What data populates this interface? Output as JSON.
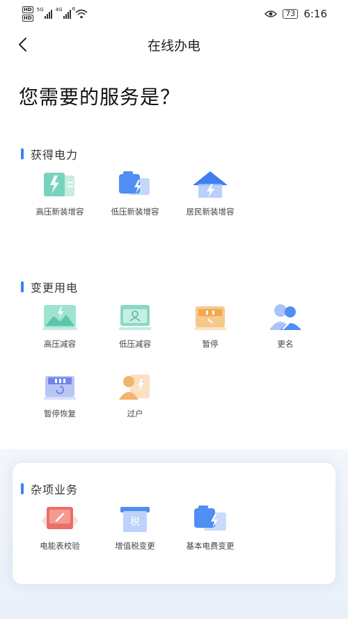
{
  "status_bar": {
    "hd1": "HD",
    "hd2": "HD",
    "net1": "5G",
    "net2": "4G",
    "wifi_badge": "6",
    "battery": "73",
    "time": "6:16"
  },
  "nav": {
    "title": "在线办电"
  },
  "page_title": "您需要的服务是？",
  "sections": [
    {
      "title": "获得电力",
      "items": [
        {
          "label": "高压新装增容",
          "icon": "high-voltage-install-icon"
        },
        {
          "label": "低压新装增容",
          "icon": "low-voltage-install-icon"
        },
        {
          "label": "居民新装增容",
          "icon": "resident-install-icon"
        }
      ]
    },
    {
      "title": "变更用电",
      "items": [
        {
          "label": "高压减容",
          "icon": "high-voltage-reduce-icon"
        },
        {
          "label": "低压减容",
          "icon": "low-voltage-reduce-icon"
        },
        {
          "label": "暂停",
          "icon": "pause-icon"
        },
        {
          "label": "更名",
          "icon": "rename-icon"
        },
        {
          "label": "暂停恢复",
          "icon": "pause-resume-icon"
        },
        {
          "label": "过户",
          "icon": "transfer-icon"
        }
      ]
    },
    {
      "title": "杂项业务",
      "items": [
        {
          "label": "电能表校验",
          "icon": "meter-check-icon"
        },
        {
          "label": "增值税变更",
          "icon": "vat-change-icon"
        },
        {
          "label": "基本电费变更",
          "icon": "basic-fee-change-icon"
        }
      ]
    }
  ],
  "icon_glyphs": {
    "vat": "税"
  },
  "colors": {
    "accent": "#3f82f0"
  }
}
